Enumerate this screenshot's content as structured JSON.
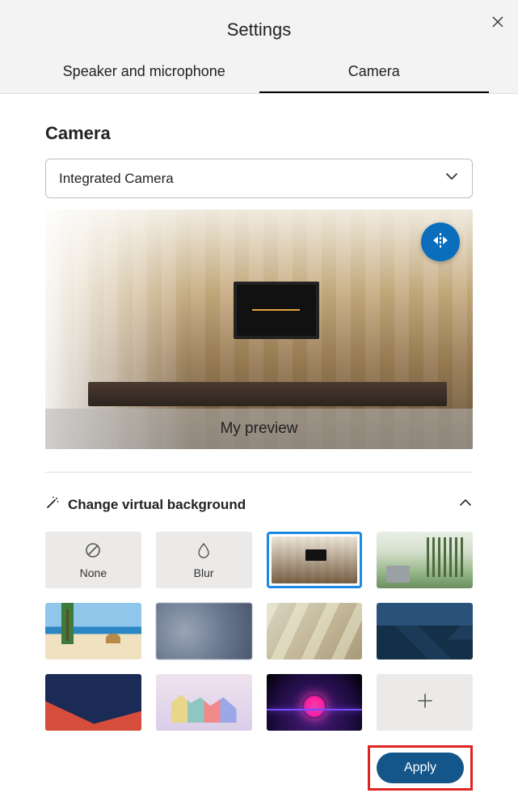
{
  "header": {
    "title": "Settings",
    "close_aria": "Close"
  },
  "tabs": {
    "speaker": "Speaker and microphone",
    "camera": "Camera",
    "active": "camera"
  },
  "camera_section": {
    "heading": "Camera",
    "selected_device": "Integrated Camera"
  },
  "preview": {
    "label": "My preview",
    "flip_aria": "Mirror video"
  },
  "virtual_background": {
    "title": "Change virtual background",
    "expanded": true,
    "tiles": [
      {
        "id": "none",
        "label": "None",
        "kind": "grey-icon"
      },
      {
        "id": "blur",
        "label": "Blur",
        "kind": "grey-icon"
      },
      {
        "id": "office",
        "label": "",
        "kind": "image",
        "selected": true
      },
      {
        "id": "forest",
        "label": "",
        "kind": "image"
      },
      {
        "id": "beach",
        "label": "",
        "kind": "image"
      },
      {
        "id": "bokeh1",
        "label": "",
        "kind": "image"
      },
      {
        "id": "bokeh2",
        "label": "",
        "kind": "image"
      },
      {
        "id": "mountain",
        "label": "",
        "kind": "image"
      },
      {
        "id": "geo",
        "label": "",
        "kind": "image"
      },
      {
        "id": "pastel",
        "label": "",
        "kind": "image"
      },
      {
        "id": "neon",
        "label": "",
        "kind": "image"
      },
      {
        "id": "add",
        "label": "",
        "kind": "add"
      }
    ]
  },
  "footer": {
    "apply": "Apply"
  },
  "highlights": {
    "selected_tile": true,
    "apply_button": true
  },
  "colors": {
    "accent": "#14568a",
    "highlight": "#e02424",
    "select_ring": "#1e88e5"
  }
}
